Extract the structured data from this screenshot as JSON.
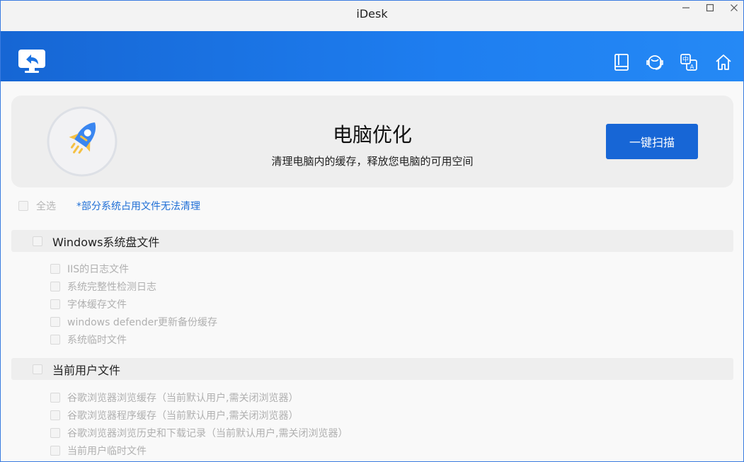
{
  "window": {
    "title": "iDesk"
  },
  "header": {
    "icons": [
      "back-home-icon",
      "book-icon",
      "support-headset-icon",
      "translate-icon",
      "home-icon"
    ]
  },
  "hero": {
    "title": "电脑优化",
    "subtitle": "清理电脑内的缓存，释放您电脑的可用空间",
    "scan_button": "一键扫描",
    "logo_icon": "rocket-icon"
  },
  "select_all": {
    "label": "全选",
    "notice": "*部分系统占用文件无法清理"
  },
  "sections": [
    {
      "title": "Windows系统盘文件",
      "items": [
        "IIS的日志文件",
        "系统完整性检测日志",
        "字体缓存文件",
        "windows defender更新备份缓存",
        "系统临时文件"
      ]
    },
    {
      "title": "当前用户文件",
      "items": [
        "谷歌浏览器浏览缓存（当前默认用户,需关闭浏览器）",
        "谷歌浏览器程序缓存（当前默认用户,需关闭浏览器）",
        "谷歌浏览器浏览历史和下载记录（当前默认用户,需关闭浏览器）",
        "当前用户临时文件"
      ]
    }
  ],
  "colors": {
    "accent": "#1766d6",
    "header_start": "#1666d4",
    "header_end": "#2589f5",
    "notice": "#1f6fd6"
  }
}
